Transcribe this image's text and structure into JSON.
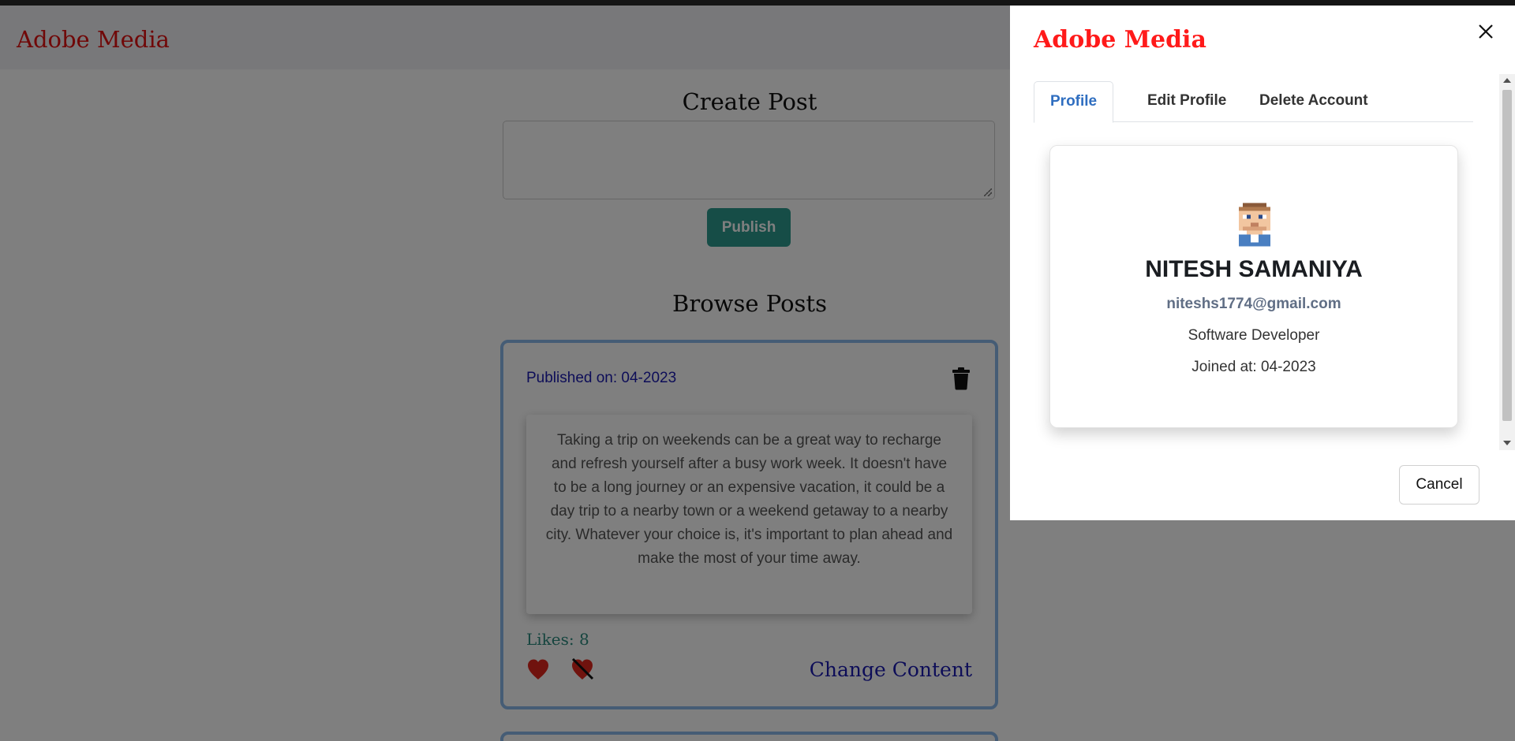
{
  "navbar": {
    "brand": "Adobe Media"
  },
  "create": {
    "title": "Create Post",
    "textarea_value": "",
    "publish_label": "Publish"
  },
  "browse": {
    "title": "Browse Posts"
  },
  "post": {
    "published": "Published on: 04-2023",
    "content": "Taking a trip on weekends can be a great way to recharge and refresh yourself after a busy work week. It doesn't have to be a long journey or an expensive vacation, it could be a day trip to a nearby town or a weekend getaway to a nearby city. Whatever your choice is, it's important to plan ahead and make the most of your time away.",
    "likes": "Likes: 8",
    "change_label": "Change Content",
    "icons": {
      "delete": "trash-icon",
      "like": "heart-icon",
      "dislike": "heart-slash-icon"
    }
  },
  "offcanvas": {
    "title": "Adobe Media",
    "tabs": [
      {
        "label": "Profile",
        "active": true
      },
      {
        "label": "Edit Profile",
        "active": false
      },
      {
        "label": "Delete Account",
        "active": false
      }
    ],
    "profile": {
      "name": "NITESH SAMANIYA",
      "email": "niteshs1774@gmail.com",
      "role": "Software Developer",
      "joined": "Joined at: 04-2023"
    },
    "cancel_label": "Cancel"
  },
  "colors": {
    "brand": "#e01010",
    "primary": "#2c9a8f",
    "link": "#1a1ab0",
    "tab_active": "#2f6ec0",
    "card_border": "#8ab8ea"
  }
}
